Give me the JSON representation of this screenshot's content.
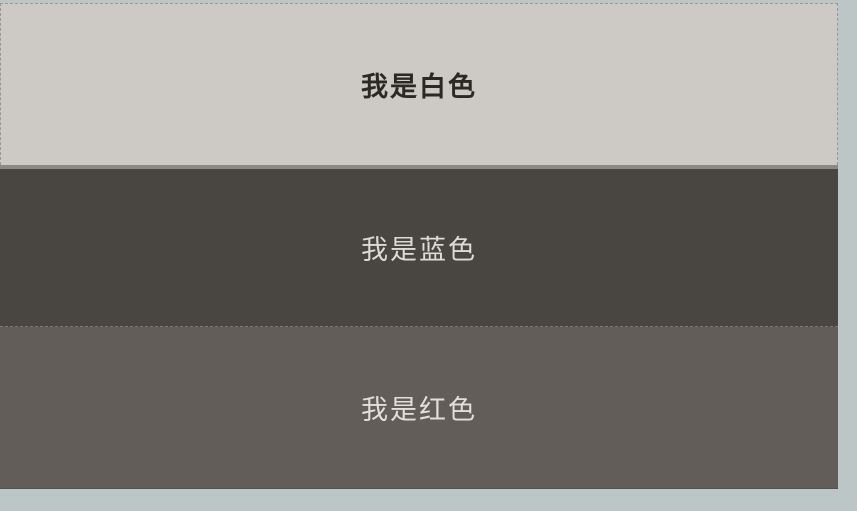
{
  "panels": [
    {
      "label": "我是白色",
      "background": "#cdc9c4",
      "text_color": "#2b2926"
    },
    {
      "label": "我是蓝色",
      "background": "#494541",
      "text_color": "#dedbd7"
    },
    {
      "label": "我是红色",
      "background": "#625d59",
      "text_color": "#e2dfdb"
    }
  ],
  "page_background": "#bcc6c6"
}
